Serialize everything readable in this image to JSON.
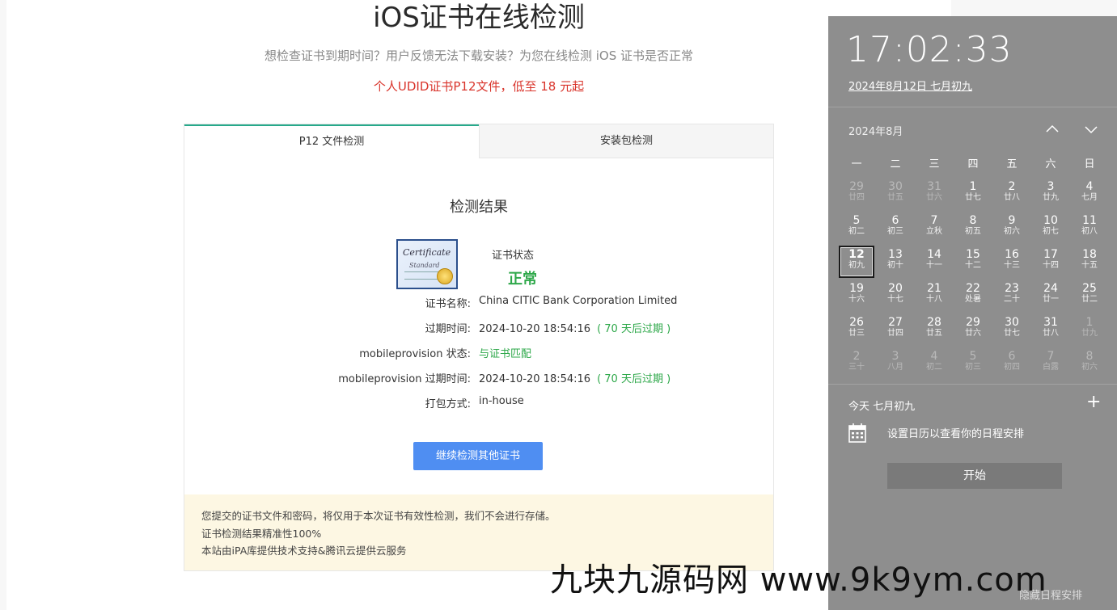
{
  "page": {
    "title": "iOS证书在线检测",
    "subtitle": "想检查证书到期时间？用户反馈无法下载安装？为您在线检测 iOS 证书是否正常",
    "promo": "个人UDID证书P12文件，低至 18 元起"
  },
  "tabs": [
    {
      "label": "P12 文件检测",
      "active": true
    },
    {
      "label": "安装包检测",
      "active": false
    }
  ],
  "result": {
    "title": "检测结果",
    "cert_image_text": [
      "Certificate",
      "Standard"
    ],
    "status_label": "证书状态",
    "status_value": "正常",
    "rows": [
      {
        "key": "证书名称:",
        "value": "China CITIC Bank Corporation Limited",
        "note": ""
      },
      {
        "key": "过期时间:",
        "value": "2024-10-20 18:54:16",
        "note": "( 70 天后过期 )"
      },
      {
        "key": "mobileprovision 状态:",
        "value": "与证书匹配",
        "note": ""
      },
      {
        "key": "mobileprovision 过期时间:",
        "value": "2024-10-20 18:54:16",
        "note": "( 70 天后过期 )"
      },
      {
        "key": "打包方式:",
        "value": "in-house",
        "note": ""
      }
    ],
    "button_label": "继续检测其他证书"
  },
  "notice": [
    "您提交的证书文件和密码，将仅用于本次证书有效性检测，我们不会进行存储。",
    "证书检测结果精准性100%",
    "本站由iPA库提供技术支持&腾讯云提供云服务"
  ],
  "calendar": {
    "time": "17:02:33",
    "date_link": "2024年8月12日 七月初九",
    "month_label": "2024年8月",
    "weekdays": [
      "一",
      "二",
      "三",
      "四",
      "五",
      "六",
      "日"
    ],
    "weeks": [
      [
        {
          "n": "29",
          "l": "廿四",
          "dim": true
        },
        {
          "n": "30",
          "l": "廿五",
          "dim": true
        },
        {
          "n": "31",
          "l": "廿六",
          "dim": true
        },
        {
          "n": "1",
          "l": "廿七"
        },
        {
          "n": "2",
          "l": "廿八"
        },
        {
          "n": "3",
          "l": "廿九"
        },
        {
          "n": "4",
          "l": "七月"
        }
      ],
      [
        {
          "n": "5",
          "l": "初二"
        },
        {
          "n": "6",
          "l": "初三"
        },
        {
          "n": "7",
          "l": "立秋"
        },
        {
          "n": "8",
          "l": "初五"
        },
        {
          "n": "9",
          "l": "初六"
        },
        {
          "n": "10",
          "l": "初七"
        },
        {
          "n": "11",
          "l": "初八"
        }
      ],
      [
        {
          "n": "12",
          "l": "初九",
          "today": true
        },
        {
          "n": "13",
          "l": "初十"
        },
        {
          "n": "14",
          "l": "十一"
        },
        {
          "n": "15",
          "l": "十二"
        },
        {
          "n": "16",
          "l": "十三"
        },
        {
          "n": "17",
          "l": "十四"
        },
        {
          "n": "18",
          "l": "十五"
        }
      ],
      [
        {
          "n": "19",
          "l": "十六"
        },
        {
          "n": "20",
          "l": "十七"
        },
        {
          "n": "21",
          "l": "十八"
        },
        {
          "n": "22",
          "l": "处暑"
        },
        {
          "n": "23",
          "l": "二十"
        },
        {
          "n": "24",
          "l": "廿一"
        },
        {
          "n": "25",
          "l": "廿二"
        }
      ],
      [
        {
          "n": "26",
          "l": "廿三"
        },
        {
          "n": "27",
          "l": "廿四"
        },
        {
          "n": "28",
          "l": "廿五"
        },
        {
          "n": "29",
          "l": "廿六"
        },
        {
          "n": "30",
          "l": "廿七"
        },
        {
          "n": "31",
          "l": "廿八"
        },
        {
          "n": "1",
          "l": "廿九",
          "dim": true
        }
      ],
      [
        {
          "n": "2",
          "l": "三十",
          "dim": true
        },
        {
          "n": "3",
          "l": "八月",
          "dim": true
        },
        {
          "n": "4",
          "l": "初二",
          "dim": true
        },
        {
          "n": "5",
          "l": "初三",
          "dim": true
        },
        {
          "n": "6",
          "l": "初四",
          "dim": true
        },
        {
          "n": "7",
          "l": "白露",
          "dim": true
        },
        {
          "n": "8",
          "l": "初六",
          "dim": true
        }
      ]
    ],
    "today_label": "今天 七月初九",
    "agenda_text": "设置日历以查看你的日程安排",
    "start_label": "开始",
    "hide_agenda_label": "隐藏日程安排"
  },
  "watermark": "九块九源码网 www.9k9ym.com",
  "icons": {
    "nav_up": "chevron-up-icon",
    "nav_down": "chevron-down-icon",
    "add": "plus-icon",
    "calendar": "calendar-icon",
    "certificate": "certificate-image"
  }
}
